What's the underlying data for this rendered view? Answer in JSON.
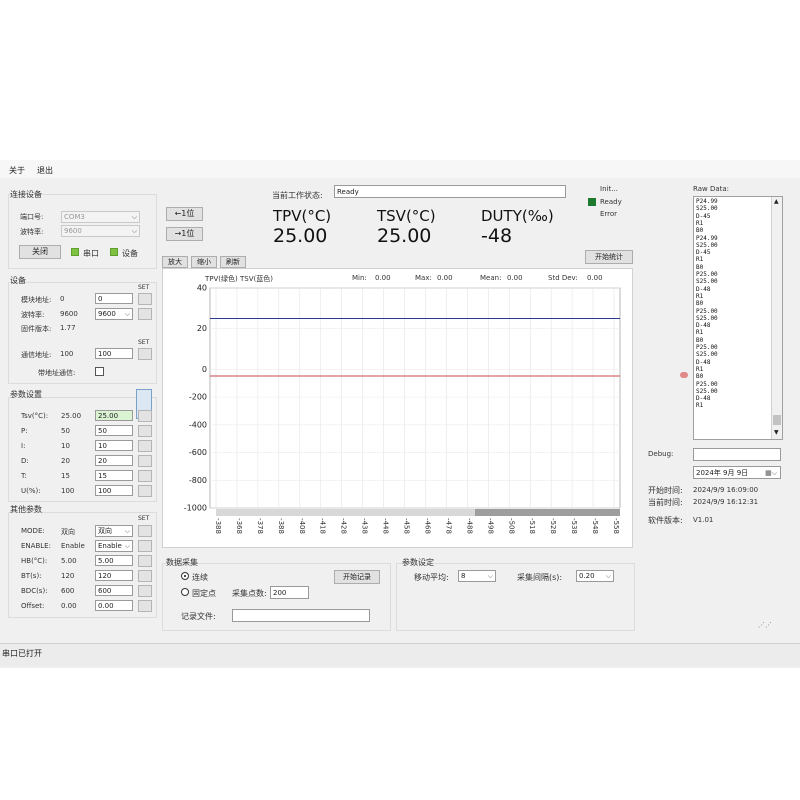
{
  "menu": {
    "about": "关于",
    "exit": "退出"
  },
  "connection": {
    "title": "连接设备",
    "port_label": "端口号:",
    "port_value": "COM3",
    "baud_label": "波特率:",
    "baud_value": "9600",
    "close_button": "关闭",
    "serial_indicator": "串口",
    "device_indicator": "设备"
  },
  "shift": {
    "left_button": "←1位",
    "right_button": "→1位"
  },
  "device": {
    "title": "设备",
    "module_addr_label": "模块地址:",
    "module_addr_value": "0",
    "module_addr_input": "0",
    "baud_label": "波特率:",
    "baud_value": "9600",
    "baud_combo": "9600",
    "firmware_label": "固件版本:",
    "firmware_value": "1.77",
    "comm_addr_label": "通信地址:",
    "comm_addr_value": "100",
    "comm_addr_input": "100",
    "addr_comm_label": "带地址通信:",
    "set": "SET"
  },
  "params": {
    "title": "参数设置",
    "rows": [
      {
        "label": "Tsv(°C):",
        "value": "25.00",
        "input": "25.00"
      },
      {
        "label": "P:",
        "value": "50",
        "input": "50"
      },
      {
        "label": "I:",
        "value": "10",
        "input": "10"
      },
      {
        "label": "D:",
        "value": "20",
        "input": "20"
      },
      {
        "label": "T:",
        "value": "15",
        "input": "15"
      },
      {
        "label": "U(%):",
        "value": "100",
        "input": "100"
      }
    ]
  },
  "other": {
    "title": "其他参数",
    "rows": [
      {
        "label": "MODE:",
        "value": "双向",
        "input": "双向"
      },
      {
        "label": "ENABLE:",
        "value": "Enable",
        "input": "Enable"
      },
      {
        "label": "HB(°C):",
        "value": "5.00",
        "input": "5.00"
      },
      {
        "label": "BT(s):",
        "value": "120",
        "input": "120"
      },
      {
        "label": "BDC(s):",
        "value": "600",
        "input": "600"
      },
      {
        "label": "Offset:",
        "value": "0.00",
        "input": "0.00"
      }
    ]
  },
  "status": {
    "label": "当前工作状态:",
    "value": "Ready"
  },
  "legend": {
    "init": "Init...",
    "ready": "Ready",
    "error": "Error"
  },
  "readings": {
    "tpv_label": "TPV(°C)",
    "tpv_value": "25.00",
    "tsv_label": "TSV(°C)",
    "tsv_value": "25.00",
    "duty_label": "DUTY(‰)",
    "duty_value": "-48"
  },
  "chart_toolbar": {
    "zoom_in": "放大",
    "zoom_out": "缩小",
    "refresh": "刷新",
    "start_stats": "开始统计"
  },
  "chart_stats": {
    "series_label": "TPV(绿色)  TSV(蓝色)",
    "min_label": "Min:",
    "min_value": "0.00",
    "max_label": "Max:",
    "max_value": "0.00",
    "mean_label": "Mean:",
    "mean_value": "0.00",
    "std_label": "Std Dev:",
    "std_value": "0.00"
  },
  "chart_data": {
    "type": "line",
    "ylim": [
      -1000,
      40
    ],
    "y_ticks": [
      40,
      20,
      0,
      -200,
      -400,
      -600,
      -800,
      -1000
    ],
    "x_ticks": [
      "-388",
      "-368",
      "-378",
      "-388",
      "-408",
      "-418",
      "-428",
      "-438",
      "-448",
      "-458",
      "-468",
      "-478",
      "-488",
      "-498",
      "-508",
      "-518",
      "-528",
      "-538",
      "-548",
      "-558"
    ],
    "grid": true,
    "series": [
      {
        "name": "TSV",
        "color": "#2b3a8f",
        "values": [
          25,
          25
        ]
      },
      {
        "name": "TPV",
        "color": "#c44a4a",
        "values": [
          -48,
          -48
        ]
      }
    ]
  },
  "acquisition": {
    "title": "数据采集",
    "continuous": "连续",
    "fixed": "固定点",
    "points_label": "采集点数:",
    "points_value": "200",
    "record_button": "开始记录",
    "file_label": "记录文件:"
  },
  "acq_params": {
    "title": "参数设定",
    "moving_avg_label": "移动平均:",
    "moving_avg_value": "8",
    "interval_label": "采集间隔(s):",
    "interval_value": "0.20"
  },
  "raw": {
    "title": "Raw Data:",
    "lines": [
      "P24.99",
      "S25.00",
      "D-45",
      "R1",
      "B0",
      "P24.99",
      "S25.00",
      "D-45",
      "R1",
      "B0",
      "P25.00",
      "S25.00",
      "D-48",
      "R1",
      "B0",
      "P25.00",
      "S25.00",
      "D-48",
      "R1",
      "B0",
      "P25.00",
      "S25.00",
      "D-48",
      "R1",
      "B0",
      "P25.00",
      "S25.00",
      "D-48",
      "R1"
    ]
  },
  "debug": {
    "label": "Debug:"
  },
  "date_picker": {
    "value": "2024年 9月 9日"
  },
  "times": {
    "start_label": "开始时间:",
    "start_value": "2024/9/9 16:09:00",
    "current_label": "当前时间:",
    "current_value": "2024/9/9 16:12:31",
    "version_label": "软件版本:",
    "version_value": "V1.01"
  },
  "statusbar": {
    "text": "串口已打开"
  }
}
